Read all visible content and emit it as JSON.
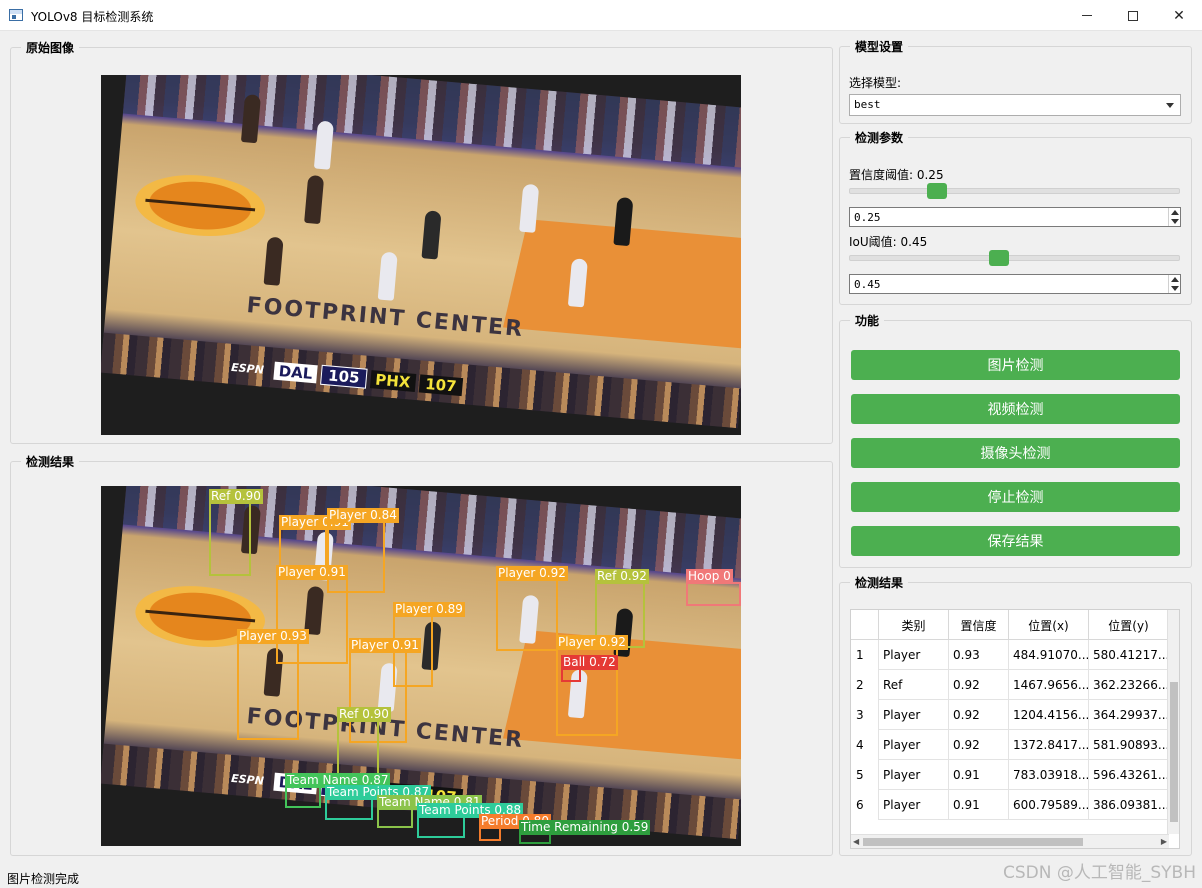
{
  "window": {
    "title": "YOLOv8 目标检测系统"
  },
  "original_panel": {
    "title": "原始图像"
  },
  "result_panel": {
    "title": "检测结果"
  },
  "scene": {
    "court_logo": "FOOTPRINT CENTER",
    "scorebug": {
      "brand": "ESPN",
      "team1": "DAL",
      "score1": "105",
      "team2": "PHX",
      "score2": "107"
    }
  },
  "detections": [
    {
      "label": "Ref 0.90",
      "color": "#b5c23c"
    },
    {
      "label": "Player 0.91",
      "color": "#f5a623"
    },
    {
      "label": "Player 0.84",
      "color": "#f5a623"
    },
    {
      "label": "Player 0.91",
      "color": "#f5a623"
    },
    {
      "label": "Player 0.92",
      "color": "#f5a623"
    },
    {
      "label": "Ref 0.92",
      "color": "#b5c23c"
    },
    {
      "label": "Hoop 0",
      "color": "#f07878"
    },
    {
      "label": "Player 0.89",
      "color": "#f5a623"
    },
    {
      "label": "Player 0.93",
      "color": "#f5a623"
    },
    {
      "label": "Player 0.91",
      "color": "#f5a623"
    },
    {
      "label": "Player 0.92",
      "color": "#f5a623"
    },
    {
      "label": "Ball 0.72",
      "color": "#e53935"
    },
    {
      "label": "Ref 0.90",
      "color": "#b5c23c"
    },
    {
      "label": "Team Name 0.87",
      "color": "#43c45a"
    },
    {
      "label": "Team Points 0.87",
      "color": "#2ecc9a"
    },
    {
      "label": "Team Name 0.81",
      "color": "#8bc34a"
    },
    {
      "label": "Team Points 0.88",
      "color": "#2ecc9a"
    },
    {
      "label": "Period 0.80",
      "color": "#f47c2c"
    },
    {
      "label": "Time Remaining 0.59",
      "color": "#2e9e3e"
    }
  ],
  "model_settings": {
    "title": "模型设置",
    "select_label": "选择模型:",
    "selected_model": "best"
  },
  "detection_params": {
    "title": "检测参数",
    "conf_label": "置信度阈值: 0.25",
    "conf_value": "0.25",
    "conf_level": 0.25,
    "iou_label": "IoU阈值: 0.45",
    "iou_value": "0.45",
    "iou_level": 0.45
  },
  "functions": {
    "title": "功能",
    "buttons": [
      "图片检测",
      "视频检测",
      "摄像头检测",
      "停止检测",
      "保存结果"
    ],
    "button_color": "#4caf50"
  },
  "results_table": {
    "title": "检测结果",
    "headers": [
      "类别",
      "置信度",
      "位置(x)",
      "位置(y)"
    ],
    "rows": [
      {
        "idx": "1",
        "cls": "Player",
        "conf": "0.93",
        "x": "484.91070...",
        "y": "580.41217..."
      },
      {
        "idx": "2",
        "cls": "Ref",
        "conf": "0.92",
        "x": "1467.9656...",
        "y": "362.23266..."
      },
      {
        "idx": "3",
        "cls": "Player",
        "conf": "0.92",
        "x": "1204.4156...",
        "y": "364.29937..."
      },
      {
        "idx": "4",
        "cls": "Player",
        "conf": "0.92",
        "x": "1372.8417...",
        "y": "581.90893..."
      },
      {
        "idx": "5",
        "cls": "Player",
        "conf": "0.91",
        "x": "783.03918...",
        "y": "596.43261..."
      },
      {
        "idx": "6",
        "cls": "Player",
        "conf": "0.91",
        "x": "600.79589...",
        "y": "386.09381..."
      }
    ]
  },
  "status": {
    "text": "图片检测完成"
  },
  "watermark": "CSDN @人工智能_SYBH"
}
